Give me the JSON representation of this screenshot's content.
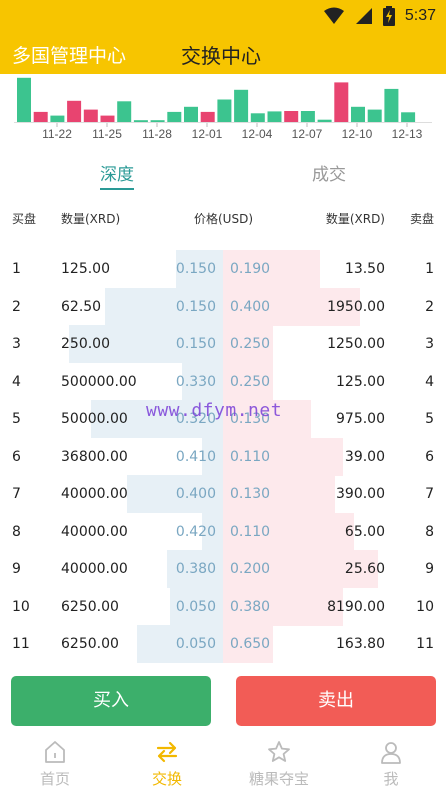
{
  "status_bar": {
    "time": "5:37"
  },
  "header": {
    "app_title": "多国管理中心",
    "page_title": "交换中心"
  },
  "mini_chart": {
    "dates": [
      "11-22",
      "11-25",
      "11-28",
      "12-01",
      "12-04",
      "12-07",
      "12-10",
      "12-13"
    ],
    "bars": [
      {
        "color": "green",
        "level": 0.96
      },
      {
        "color": "red",
        "level": 0.22
      },
      {
        "color": "green",
        "level": 0.14
      },
      {
        "color": "red",
        "level": 0.46
      },
      {
        "color": "red",
        "level": 0.27
      },
      {
        "color": "red",
        "level": 0.14
      },
      {
        "color": "green",
        "level": 0.45
      },
      {
        "color": "green",
        "level": 0.04
      },
      {
        "color": "green",
        "level": 0.04
      },
      {
        "color": "green",
        "level": 0.22
      },
      {
        "color": "green",
        "level": 0.33
      },
      {
        "color": "red",
        "level": 0.22
      },
      {
        "color": "green",
        "level": 0.49
      },
      {
        "color": "green",
        "level": 0.7
      },
      {
        "color": "green",
        "level": 0.19
      },
      {
        "color": "green",
        "level": 0.23
      },
      {
        "color": "red",
        "level": 0.24
      },
      {
        "color": "green",
        "level": 0.24
      },
      {
        "color": "green",
        "level": 0.05
      },
      {
        "color": "red",
        "level": 0.86
      },
      {
        "color": "green",
        "level": 0.33
      },
      {
        "color": "green",
        "level": 0.27
      },
      {
        "color": "green",
        "level": 0.72
      },
      {
        "color": "green",
        "level": 0.21
      }
    ],
    "colors": {
      "green": "#3cc48f",
      "red": "#e84470"
    }
  },
  "tabs": {
    "depth": "深度",
    "trades": "成交"
  },
  "columns": {
    "buy": "买盘",
    "bid_qty": "数量(XRD)",
    "price": "价格(USD)",
    "ask_qty": "数量(XRD)",
    "sell": "卖盘"
  },
  "order_book": [
    {
      "idx": "1",
      "bid_qty": "125.00",
      "bid_price": "0.150",
      "ask_price": "0.190",
      "ask_qty": "13.50",
      "idx2": "1",
      "bid_depth": 0.25,
      "ask_depth": 0.52
    },
    {
      "idx": "2",
      "bid_qty": "62.50",
      "bid_price": "0.150",
      "ask_price": "0.400",
      "ask_qty": "1950.00",
      "idx2": "2",
      "bid_depth": 0.63,
      "ask_depth": 0.73
    },
    {
      "idx": "3",
      "bid_qty": "250.00",
      "bid_price": "0.150",
      "ask_price": "0.250",
      "ask_qty": "1250.00",
      "idx2": "3",
      "bid_depth": 0.82,
      "ask_depth": 0.27
    },
    {
      "idx": "4",
      "bid_qty": "500000.00",
      "bid_price": "0.330",
      "ask_price": "0.250",
      "ask_qty": "125.00",
      "idx2": "4",
      "bid_depth": 0.22,
      "ask_depth": 0.27
    },
    {
      "idx": "5",
      "bid_qty": "50000.00",
      "bid_price": "0.320",
      "ask_price": "0.130",
      "ask_qty": "975.00",
      "idx2": "5",
      "bid_depth": 0.7,
      "ask_depth": 0.47
    },
    {
      "idx": "6",
      "bid_qty": "36800.00",
      "bid_price": "0.410",
      "ask_price": "0.110",
      "ask_qty": "39.00",
      "idx2": "6",
      "bid_depth": 0.11,
      "ask_depth": 0.64
    },
    {
      "idx": "7",
      "bid_qty": "40000.00",
      "bid_price": "0.400",
      "ask_price": "0.130",
      "ask_qty": "390.00",
      "idx2": "7",
      "bid_depth": 0.51,
      "ask_depth": 0.6
    },
    {
      "idx": "8",
      "bid_qty": "40000.00",
      "bid_price": "0.420",
      "ask_price": "0.110",
      "ask_qty": "65.00",
      "idx2": "8",
      "bid_depth": 0.11,
      "ask_depth": 0.7
    },
    {
      "idx": "9",
      "bid_qty": "40000.00",
      "bid_price": "0.380",
      "ask_price": "0.200",
      "ask_qty": "25.60",
      "idx2": "9",
      "bid_depth": 0.3,
      "ask_depth": 0.83
    },
    {
      "idx": "10",
      "bid_qty": "6250.00",
      "bid_price": "0.050",
      "ask_price": "0.380",
      "ask_qty": "8190.00",
      "idx2": "10",
      "bid_depth": 0.28,
      "ask_depth": 0.64
    },
    {
      "idx": "11",
      "bid_qty": "6250.00",
      "bid_price": "0.050",
      "ask_price": "0.650",
      "ask_qty": "163.80",
      "idx2": "11",
      "bid_depth": 0.46,
      "ask_depth": 0.27
    }
  ],
  "watermark": "www.dfym.net",
  "actions": {
    "buy": "买入",
    "sell": "卖出"
  },
  "nav": [
    {
      "label": "首页",
      "icon": "home-icon",
      "active": false
    },
    {
      "label": "交换",
      "icon": "exchange-icon",
      "active": true
    },
    {
      "label": "糖果夺宝",
      "icon": "star-icon",
      "active": false
    },
    {
      "label": "我",
      "icon": "user-icon",
      "active": false
    }
  ]
}
